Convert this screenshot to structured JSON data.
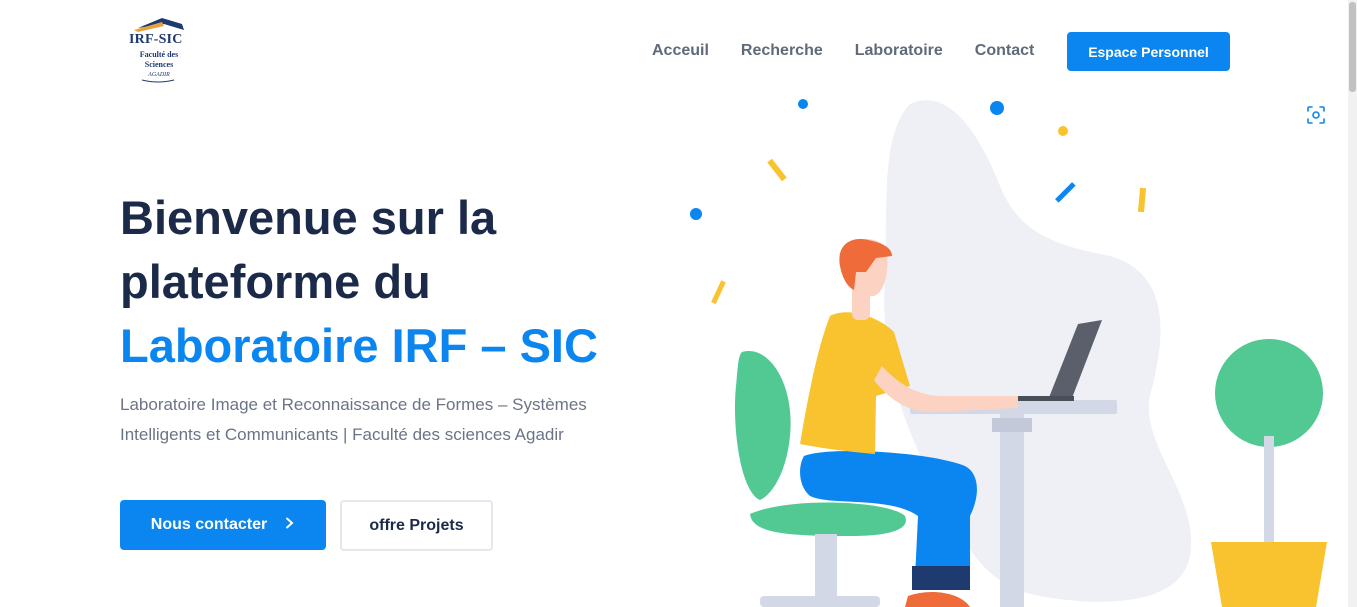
{
  "logo": {
    "title": "IRF-SIC",
    "subtitle": "Faculté des Sciences",
    "city": "AGADIR"
  },
  "nav": {
    "items": [
      {
        "label": "Acceuil"
      },
      {
        "label": "Recherche"
      },
      {
        "label": "Laboratoire"
      },
      {
        "label": "Contact"
      }
    ],
    "cta_label": "Espace Personnel"
  },
  "hero": {
    "title_line1": "Bienvenue sur la",
    "title_line2": "plateforme du",
    "title_accent": "Laboratoire IRF – SIC",
    "description_line1": "Laboratoire Image et Reconnaissance de Formes – Systèmes",
    "description_line2": "Intelligents et Communicants | Faculté des sciences Agadir",
    "primary_button": "Nous contacter",
    "primary_button_icon": "chevron-right-icon",
    "secondary_button": "offre Projets"
  },
  "icons": {
    "focus": "focus-frame-icon"
  },
  "colors": {
    "brand_blue": "#0b86f0",
    "heading": "#1c2a4a",
    "nav_text": "#5f6b7a",
    "body_text": "#6b7486"
  }
}
